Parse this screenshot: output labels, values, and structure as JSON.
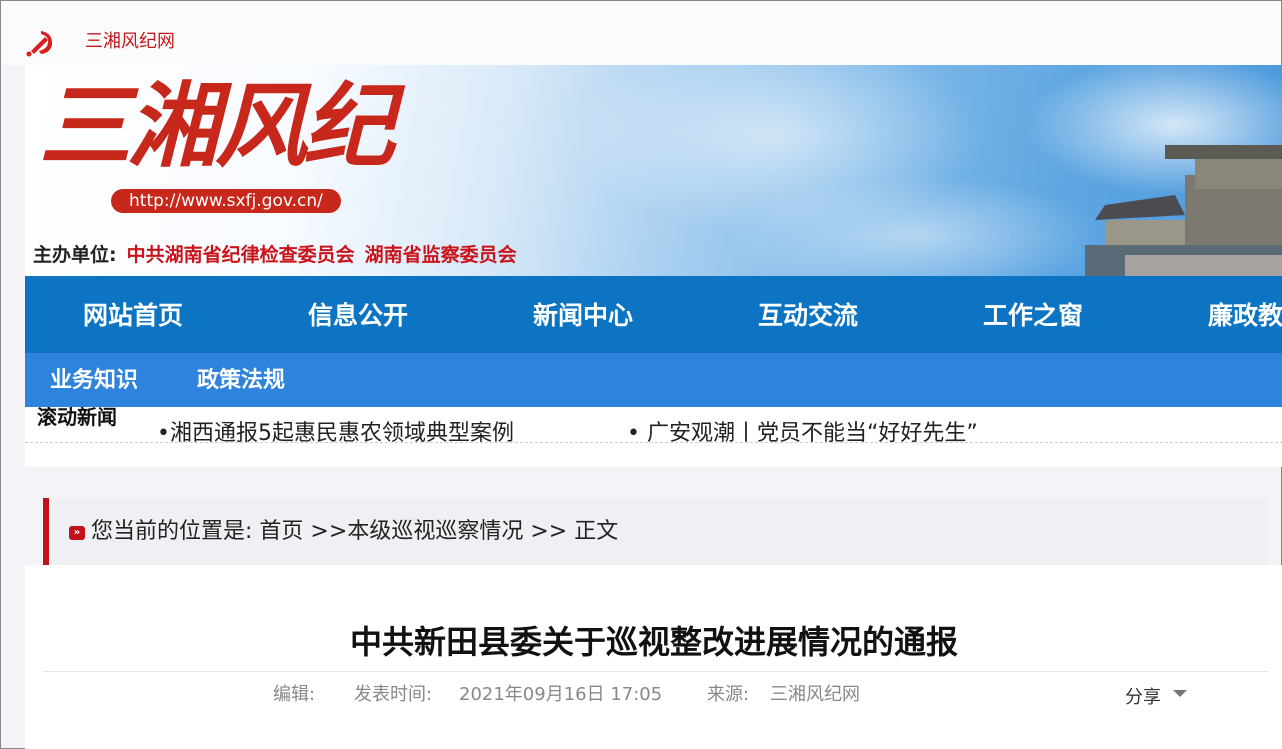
{
  "top_bar": {
    "site_link": "三湘风纪网"
  },
  "banner": {
    "logo_text": "三湘风纪",
    "logo_url": "http://www.sxfj.gov.cn/",
    "sponsor_label": "主办单位:",
    "sponsor_orgs": [
      "中共湖南省纪律检查委员会",
      "湖南省监察委员会"
    ]
  },
  "nav_main": [
    "网站首页",
    "信息公开",
    "新闻中心",
    "互动交流",
    "工作之窗",
    "廉政教"
  ],
  "nav_sub": [
    "业务知识",
    "政策法规"
  ],
  "ticker": {
    "label": "滚动新闻",
    "items": [
      "•湘西通报5起惠民惠农领域典型案例",
      "• 广安观潮丨党员不能当“好好先生”"
    ]
  },
  "breadcrumb": {
    "prefix": "您当前的位置是:",
    "home": "首页",
    "sep1": " >>",
    "section": "本级巡视巡察情况",
    "sep2": " >> ",
    "current": "正文"
  },
  "article": {
    "title": "中共新田县委关于巡视整改进展情况的通报",
    "editor_label": "编辑:",
    "publish_label": "发表时间:",
    "publish_time": "2021年09月16日 17:05",
    "source_label": "来源:",
    "source": "三湘风纪网",
    "share_label": "分享"
  },
  "colors": {
    "party_red": "#c8141a",
    "nav_main_bg": "#0c74c2",
    "nav_sub_bg": "#2e83dc"
  }
}
